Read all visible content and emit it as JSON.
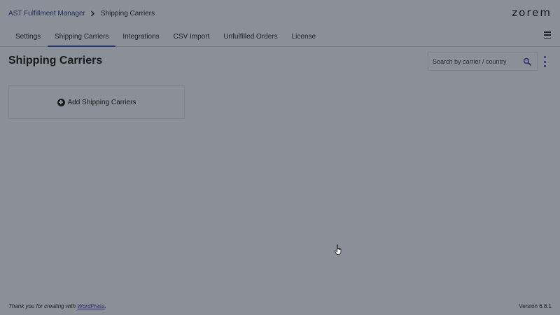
{
  "breadcrumb": {
    "parent": "AST Fulfillment Manager",
    "current": "Shipping Carriers"
  },
  "brand": {
    "logo_text": "zorem"
  },
  "tabs": [
    {
      "label": "Settings",
      "active": false
    },
    {
      "label": "Shipping Carriers",
      "active": true
    },
    {
      "label": "Integrations",
      "active": false
    },
    {
      "label": "CSV Import",
      "active": false
    },
    {
      "label": "Unfulfilled Orders",
      "active": false
    },
    {
      "label": "License",
      "active": false
    }
  ],
  "main": {
    "title": "Shipping Carriers",
    "search": {
      "placeholder": "Search by carrier / country",
      "value": ""
    },
    "add_card": {
      "label": "Add Shipping Carriers"
    }
  },
  "footer": {
    "thanks_prefix": "Thank you for creating with ",
    "thanks_link": "WordPress",
    "thanks_suffix": ".",
    "version": "Version 6.8.1"
  },
  "colors": {
    "accent": "#2a3a78",
    "background": "#8b9098"
  },
  "icons": {
    "breadcrumb_separator": "chevron-right-icon",
    "menu": "hamburger-menu-icon",
    "search": "search-icon",
    "more": "vertical-dots-icon",
    "add": "plus-circle-icon"
  }
}
